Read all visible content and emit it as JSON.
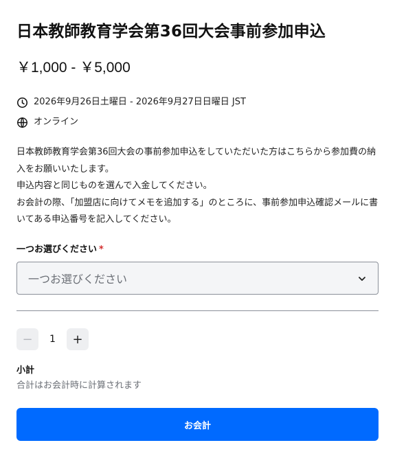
{
  "event": {
    "title": "日本教師教育学会第36回大会事前参加申込",
    "price_range": "￥1,000 - ￥5,000",
    "date_range": "2026年9月26日土曜日 - 2026年9月27日日曜日 JST",
    "location": "オンライン",
    "description": [
      "日本教師教育学会第36回大会の事前参加申込をしていただいた方はこちらから参加費の納入をお願いいたします。",
      "申込内容と同じものを選んで入金してください。",
      "お会計の際、「加盟店に向けてメモを追加する」のところに、事前参加申込確認メールに書いてある申込番号を記入してください。"
    ]
  },
  "option_select": {
    "label": "一つお選びください",
    "required_mark": "*",
    "placeholder": "一つお選びください"
  },
  "quantity": {
    "minus": "−",
    "value": "1",
    "plus": "+"
  },
  "subtotal": {
    "label": "小計",
    "note": "合計はお会計時に計算されます"
  },
  "checkout_button": "お会計",
  "icons": {
    "date": "clock-icon",
    "location": "globe-icon",
    "select": "chevron-down-icon"
  },
  "colors": {
    "accent": "#006aff",
    "required": "#d32f2f"
  }
}
